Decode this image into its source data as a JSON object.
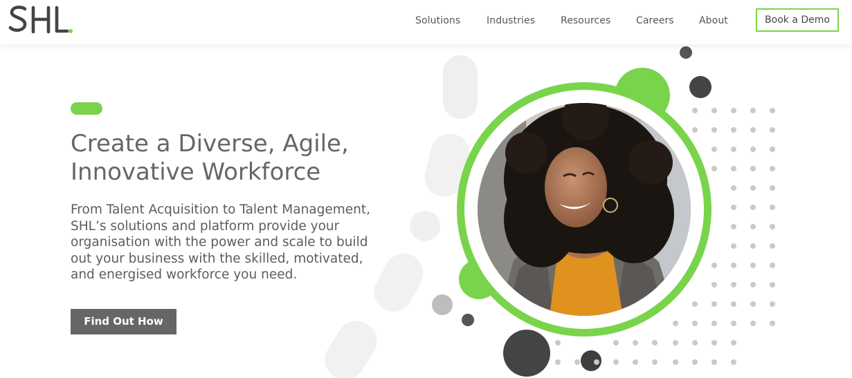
{
  "brand": {
    "logo_text": "SHL",
    "accent": "#79d44b",
    "dark": "#444444"
  },
  "nav": {
    "items": [
      {
        "label": "Solutions"
      },
      {
        "label": "Industries"
      },
      {
        "label": "Resources"
      },
      {
        "label": "Careers"
      },
      {
        "label": "About"
      }
    ],
    "cta_label": "Book a Demo"
  },
  "hero": {
    "headline_line1": "Create a Diverse, Agile,",
    "headline_line2": "Innovative Workforce",
    "body_lines": [
      "From Talent Acquisition to Talent Management,",
      "SHL’s solutions and platform provide your",
      "organisation with the power and scale to build",
      "out your business with the skilled, motivated,",
      "and energised workforce you need."
    ],
    "cta_label": "Find Out How"
  }
}
